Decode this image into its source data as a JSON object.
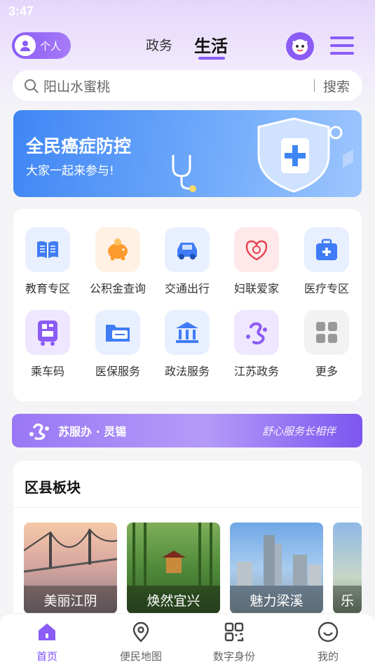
{
  "status_bar": {
    "time": "3:47"
  },
  "header": {
    "personal_label": "个人",
    "tabs": [
      {
        "label": "政务"
      },
      {
        "label": "生活",
        "active": true
      }
    ]
  },
  "search": {
    "query": "阳山水蜜桃",
    "button_label": "搜索"
  },
  "banner": {
    "title": "全民癌症防控",
    "subtitle": "大家一起来参与!"
  },
  "services": [
    {
      "label": "教育专区",
      "icon": "book-icon"
    },
    {
      "label": "公积金查询",
      "icon": "piggy-bank-icon"
    },
    {
      "label": "交通出行",
      "icon": "car-icon"
    },
    {
      "label": "妇联爱家",
      "icon": "womens-federation-icon"
    },
    {
      "label": "医疗专区",
      "icon": "medical-kit-icon"
    },
    {
      "label": "乘车码",
      "icon": "bus-qr-icon"
    },
    {
      "label": "医保服务",
      "icon": "folder-card-icon"
    },
    {
      "label": "政法服务",
      "icon": "court-building-icon"
    },
    {
      "label": "江苏政务",
      "icon": "jiangsu-logo-icon"
    },
    {
      "label": "更多",
      "icon": "grid-more-icon"
    }
  ],
  "service_banner": {
    "name": "苏服办 · 灵锡",
    "slogan": "舒心服务长相伴"
  },
  "districts": {
    "title": "区县板块",
    "items": [
      {
        "label": "美丽江阴"
      },
      {
        "label": "焕然宜兴"
      },
      {
        "label": "魅力梁溪"
      },
      {
        "label": "乐"
      }
    ]
  },
  "bottom_nav": [
    {
      "label": "首页",
      "icon": "home-icon",
      "active": true
    },
    {
      "label": "便民地图",
      "icon": "map-pin-icon"
    },
    {
      "label": "数字身份",
      "icon": "digital-id-icon"
    },
    {
      "label": "我的",
      "icon": "smile-icon"
    }
  ],
  "colors": {
    "accent": "#8b5cf6",
    "banner_blue": "#3f86f5"
  }
}
